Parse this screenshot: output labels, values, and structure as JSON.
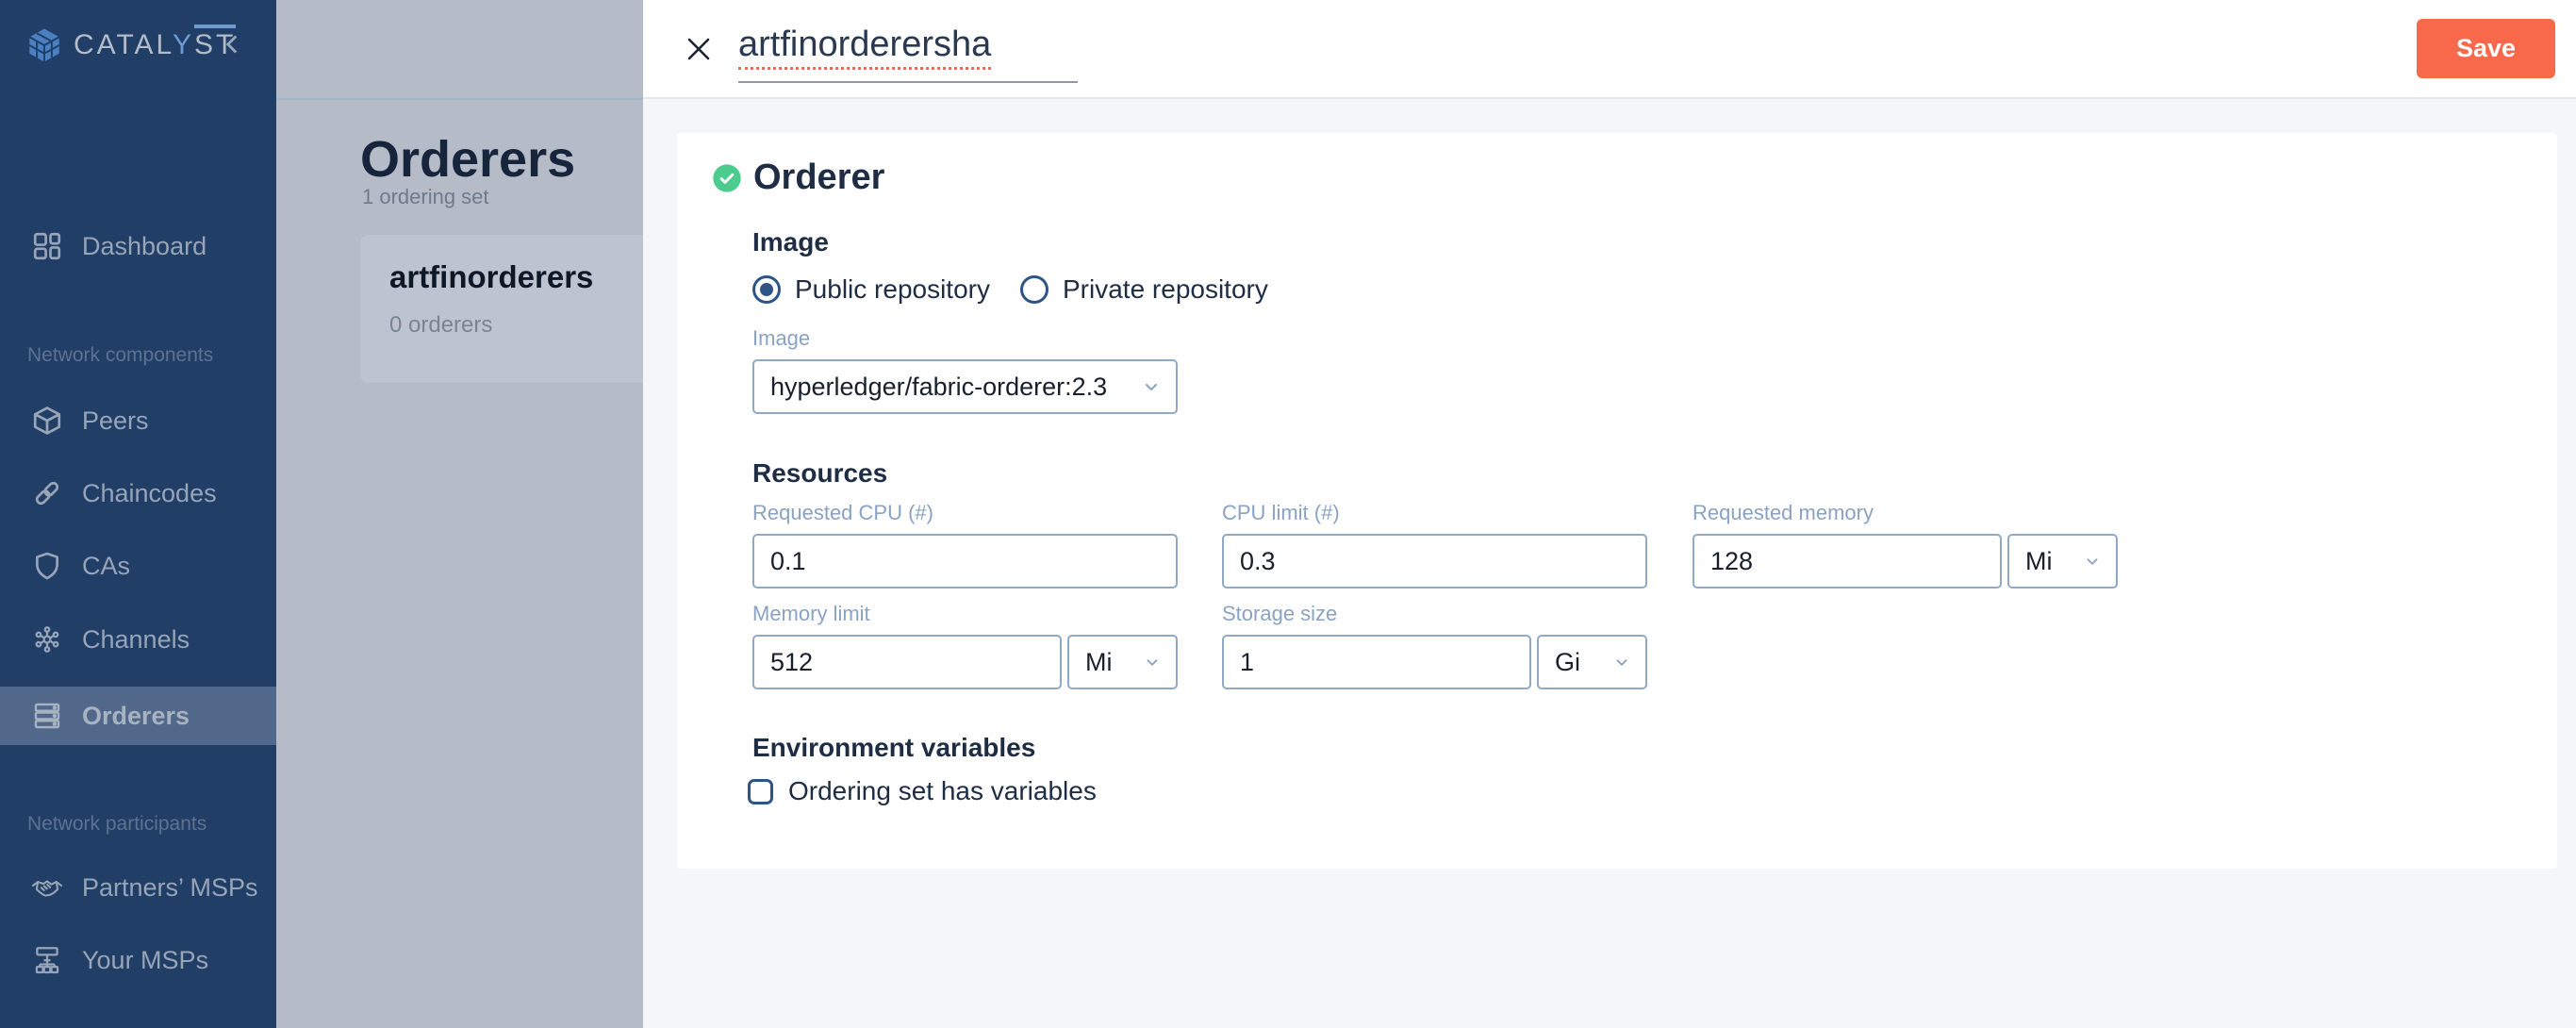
{
  "colors": {
    "sidebar_bg": "#203e66",
    "sidebar_active_bg": "#52688a",
    "accent_save": "#f8684b",
    "status_green": "#4bcb8d",
    "panel_bg": "#b5bbc7",
    "navy_text": "#1e2d44",
    "field_label_blue": "#8aa2c4",
    "input_border": "#8fa9c6"
  },
  "sidebar": {
    "brand_gray1": "CATAL",
    "brand_blue": "Y",
    "brand_gray2": "ST",
    "section_labels": [
      "Network components",
      "Network participants"
    ],
    "items": [
      {
        "label": "Dashboard",
        "icon": "dashboard-icon",
        "active": false
      },
      {
        "label": "Peers",
        "icon": "cube-icon",
        "active": false
      },
      {
        "label": "Chaincodes",
        "icon": "chain-link-icon",
        "active": false
      },
      {
        "label": "CAs",
        "icon": "shield-icon",
        "active": false
      },
      {
        "label": "Channels",
        "icon": "hub-network-icon",
        "active": false
      },
      {
        "label": "Orderers",
        "icon": "server-stack-icon",
        "active": true
      },
      {
        "label": "Partners’ MSPs",
        "icon": "handshake-icon",
        "active": false
      },
      {
        "label": "Your MSPs",
        "icon": "org-chart-icon",
        "active": false
      }
    ]
  },
  "panel": {
    "title": "Orderers",
    "subtitle": "1 ordering set",
    "card": {
      "title": "artfinorderers",
      "subtitle": "0 orderers"
    }
  },
  "drawer": {
    "name_value": "artfinorderersha",
    "save_label": "Save",
    "form": {
      "heading": "Orderer",
      "image_section": {
        "heading": "Image",
        "radio_public": "Public repository",
        "radio_private": "Private repository",
        "public_selected": true,
        "image_label": "Image",
        "image_value": "hyperledger/fabric-orderer:2.3"
      },
      "resources_section": {
        "heading": "Resources",
        "requested_cpu": {
          "label": "Requested CPU (#)",
          "value": "0.1"
        },
        "cpu_limit": {
          "label": "CPU limit (#)",
          "value": "0.3"
        },
        "requested_memory": {
          "label": "Requested memory",
          "value": "128",
          "unit": "Mi"
        },
        "memory_limit": {
          "label": "Memory limit",
          "value": "512",
          "unit": "Mi"
        },
        "storage_size": {
          "label": "Storage size",
          "value": "1",
          "unit": "Gi"
        }
      },
      "env_section": {
        "heading": "Environment variables",
        "checkbox_label": "Ordering set has variables",
        "checkbox_checked": false
      }
    }
  }
}
